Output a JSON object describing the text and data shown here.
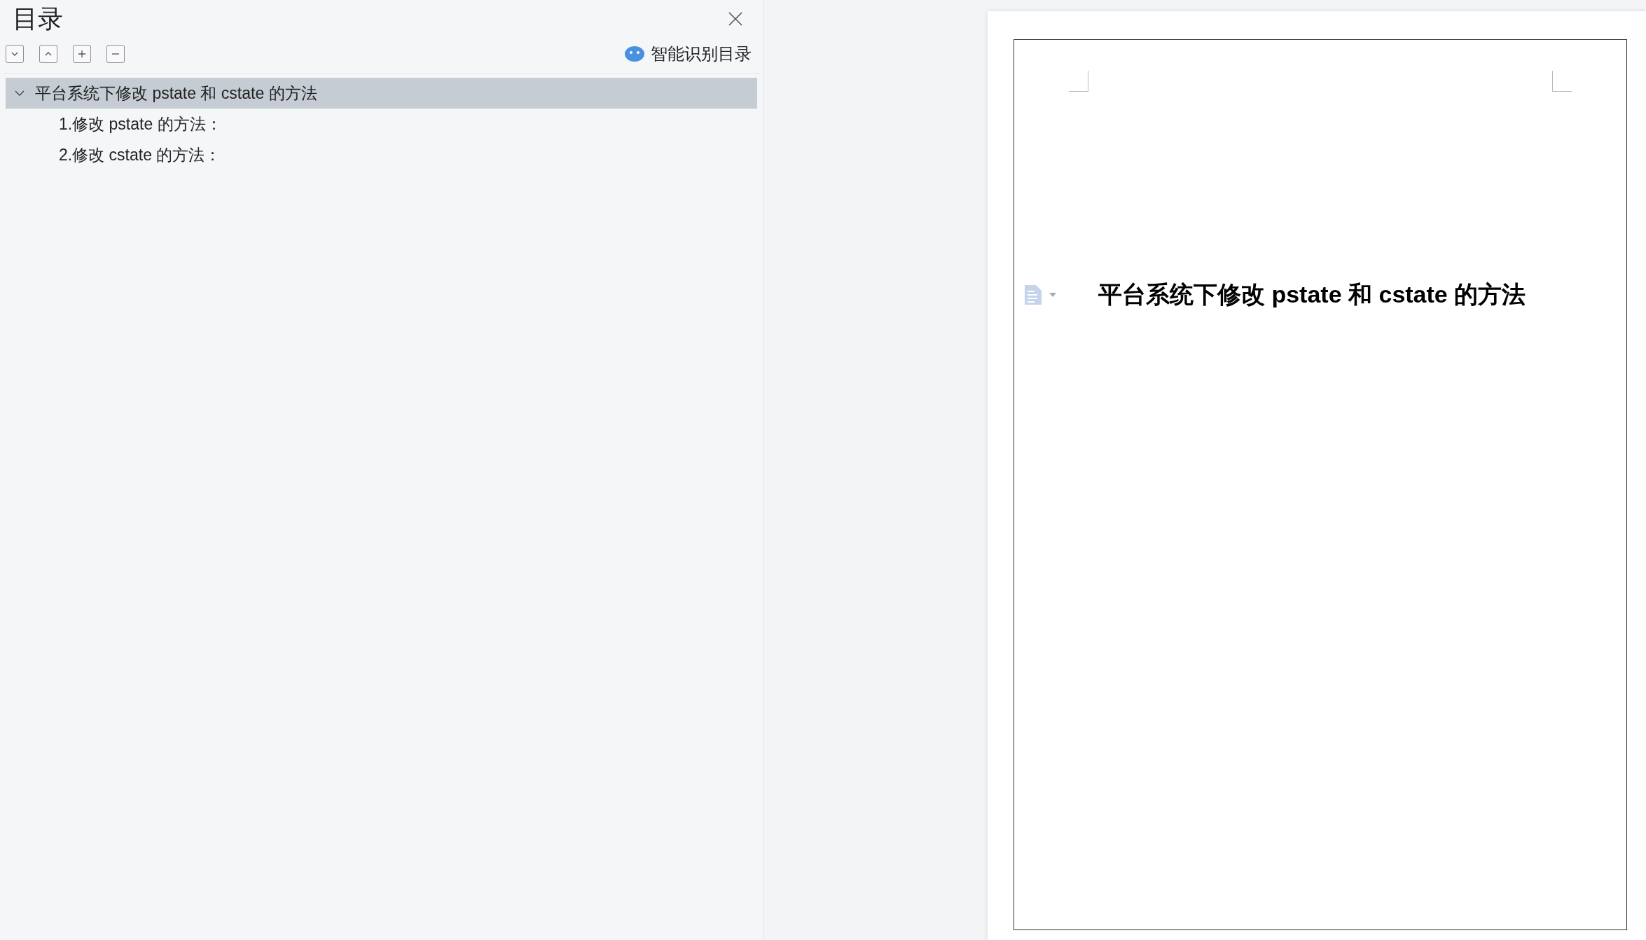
{
  "panel": {
    "title": "目录",
    "smart_button": "智能识别目录"
  },
  "outline": [
    {
      "label": "平台系统下修改 pstate 和 cstate 的方法",
      "selected": true,
      "expanded": true,
      "children": [
        {
          "label": "1.修改 pstate 的方法：",
          "selected": false
        },
        {
          "label": "2.修改 cstate 的方法：",
          "selected": false
        }
      ]
    }
  ],
  "document": {
    "heading": "平台系统下修改 pstate 和 cstate 的方法"
  }
}
